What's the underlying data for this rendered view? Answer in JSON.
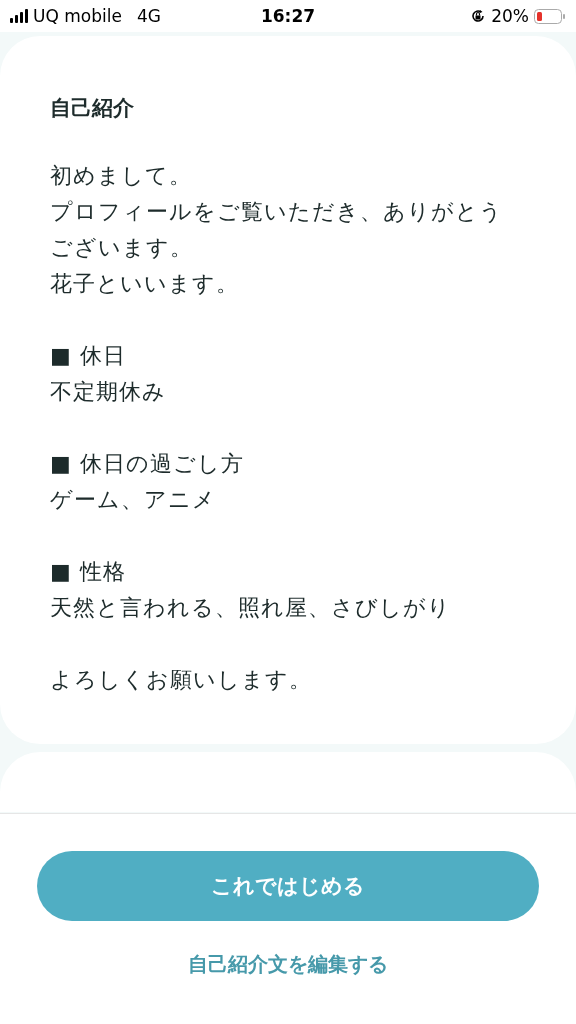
{
  "status_bar": {
    "carrier": "UQ mobile",
    "network": "4G",
    "time": "16:27",
    "battery": "20%"
  },
  "intro": {
    "title": "自己紹介",
    "paragraphs": [
      [
        "初めまして。",
        "プロフィールをご覧いただき、ありがとうございます。",
        "花子といいます。"
      ],
      [
        "■ 休日",
        "不定期休み"
      ],
      [
        "■ 休日の過ごし方",
        "ゲーム、アニメ"
      ],
      [
        "■ 性格",
        "天然と言われる、照れ屋、さびしがり"
      ],
      [
        "よろしくお願いします。"
      ]
    ]
  },
  "start_button": "これではじめる",
  "edit_link": "自己紹介文を編集する"
}
